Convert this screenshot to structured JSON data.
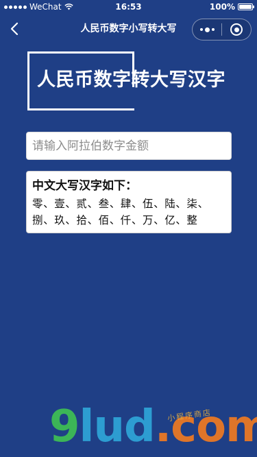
{
  "status_bar": {
    "carrier": "WeChat",
    "time": "16:53",
    "battery": "100%",
    "battery_level": 1.0
  },
  "nav": {
    "title": "人民币数字小写转大写",
    "back_icon": "chevron-left-icon",
    "more_icon": "more-dots-icon",
    "close_icon": "close-ring-icon"
  },
  "banner": {
    "title": "人民币数字转大写汉字"
  },
  "form": {
    "amount_value": "",
    "amount_placeholder": "请输入阿拉伯数字金额"
  },
  "result": {
    "heading": "中文大写汉字如下：",
    "content": "零、壹、贰、叁、肆、伍、陆、柒、捌、玖、拾、佰、仟、万、亿、整"
  },
  "watermark": {
    "part1": "9",
    "part2": "lud",
    "part3": ".com",
    "sub": "小程序商店"
  },
  "colors": {
    "background": "#1f3f86",
    "card": "#ffffff",
    "text_dark": "#111111"
  }
}
